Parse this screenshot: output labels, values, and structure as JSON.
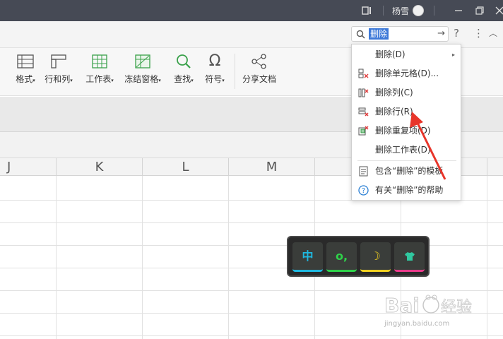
{
  "titlebar": {
    "user_name": "杨雪",
    "icons": [
      "screen-share-icon",
      "avatar",
      "minimize-icon",
      "restore-icon",
      "close-icon"
    ]
  },
  "search": {
    "value": "删除"
  },
  "topbar": {
    "help": "?",
    "more": "⋮",
    "collapse": "︿"
  },
  "ribbon": {
    "items": [
      {
        "label": "格式",
        "has_dropdown": true
      },
      {
        "label": "行和列",
        "has_dropdown": true
      },
      {
        "label": "工作表",
        "has_dropdown": true
      },
      {
        "label": "冻结窗格",
        "has_dropdown": true
      },
      {
        "label": "查找",
        "has_dropdown": true
      },
      {
        "label": "符号",
        "has_dropdown": true
      },
      {
        "label": "分享文档",
        "has_dropdown": false
      }
    ]
  },
  "grid": {
    "columns": [
      "J",
      "K",
      "L",
      "M"
    ]
  },
  "menu": {
    "items": [
      {
        "label": "删除(D)",
        "icon": "none",
        "has_submenu": true
      },
      {
        "label": "删除单元格(D)...",
        "icon": "delete-cell-icon"
      },
      {
        "label": "删除列(C)",
        "icon": "delete-column-icon"
      },
      {
        "label": "删除行(R)",
        "icon": "delete-row-icon"
      },
      {
        "label": "删除重复项(D)",
        "icon": "delete-duplicates-icon"
      },
      {
        "label": "删除工作表(D)",
        "icon": "none"
      },
      {
        "label": "包含“删除”的模板",
        "icon": "template-icon"
      },
      {
        "label": "有关“删除”的帮助",
        "icon": "help-circle-icon"
      }
    ],
    "submenu_arrow": "▸"
  },
  "ime": {
    "keys": [
      {
        "label": "中",
        "color": "#1fb8e0"
      },
      {
        "label": "o,",
        "color": "#2fd14a"
      },
      {
        "label": "☽",
        "color": "#f0d020"
      },
      {
        "label": "👕",
        "color": "#30c8a0"
      }
    ]
  },
  "watermark": {
    "brand": "Baidu经验",
    "url": "jingyan.baidu.com"
  },
  "colors": {
    "titlebar": "#464a55",
    "accent": "#3d79d8",
    "annotation_arrow": "#e8352a"
  }
}
